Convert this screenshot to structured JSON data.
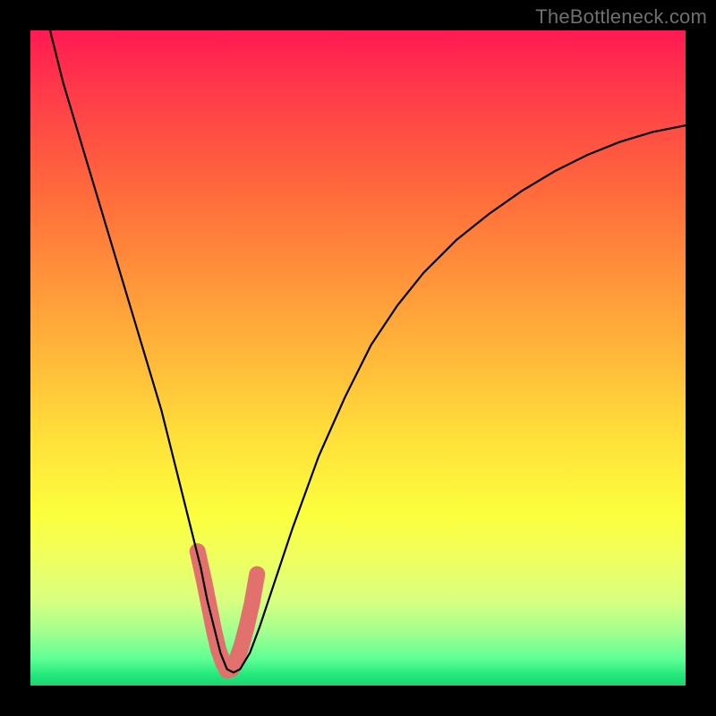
{
  "watermark": "TheBottleneck.com",
  "chart_data": {
    "type": "line",
    "title": "",
    "xlabel": "",
    "ylabel": "",
    "xlim": [
      0,
      100
    ],
    "ylim": [
      0,
      100
    ],
    "series": [
      {
        "name": "bottleneck-curve",
        "x": [
          3,
          5,
          8,
          11,
          14,
          17,
          20,
          22,
          24,
          26,
          27,
          28,
          29,
          30,
          31,
          32,
          33.5,
          35,
          37,
          40,
          44,
          48,
          52,
          56,
          60,
          65,
          70,
          75,
          80,
          85,
          90,
          95,
          100
        ],
        "values": [
          100,
          92,
          82,
          72,
          62,
          52,
          42,
          34,
          26,
          18,
          13,
          9,
          5,
          2.5,
          2,
          2.5,
          5,
          9,
          15,
          24,
          35,
          44,
          52,
          58,
          63,
          68,
          72,
          75.5,
          78.5,
          81,
          83,
          84.5,
          85.5
        ]
      }
    ],
    "highlight": {
      "name": "valley-highlight",
      "x": [
        25.5,
        26.5,
        27.3,
        28.0,
        28.7,
        29.4,
        30.0,
        30.7,
        31.4,
        32.2,
        33.0,
        33.8,
        34.6
      ],
      "values": [
        20.5,
        16.0,
        12.0,
        8.5,
        5.5,
        3.5,
        2.3,
        2.5,
        3.8,
        6.0,
        9.0,
        12.5,
        17.0
      ]
    }
  }
}
